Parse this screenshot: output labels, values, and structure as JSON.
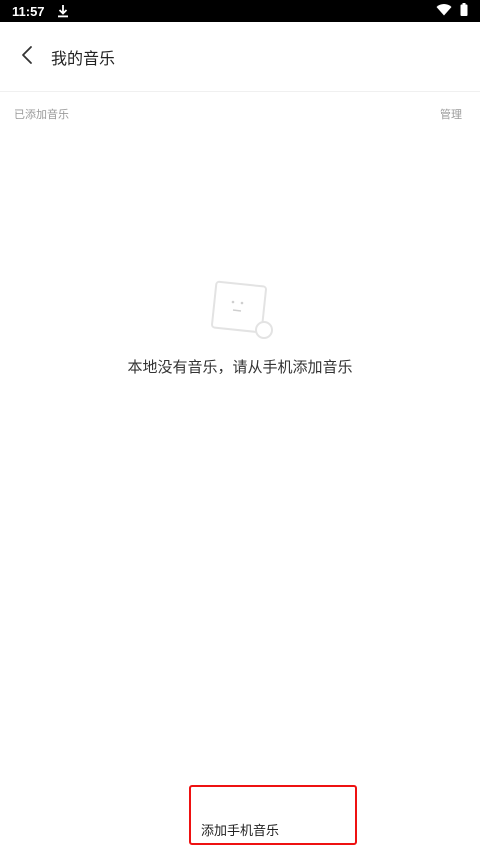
{
  "status_bar": {
    "time": "11:57",
    "icons": [
      "download-icon",
      "wifi-icon",
      "battery-icon"
    ]
  },
  "header": {
    "title": "我的音乐",
    "back_icon": "chevron-left-icon"
  },
  "subbar": {
    "left_label": "已添加音乐",
    "right_action": "管理"
  },
  "empty_state": {
    "icon": "music-note-empty-icon",
    "message": "本地没有音乐，请从手机添加音乐"
  },
  "footer": {
    "add_button_label": "添加手机音乐",
    "add_button_border_color": "#e11111"
  }
}
